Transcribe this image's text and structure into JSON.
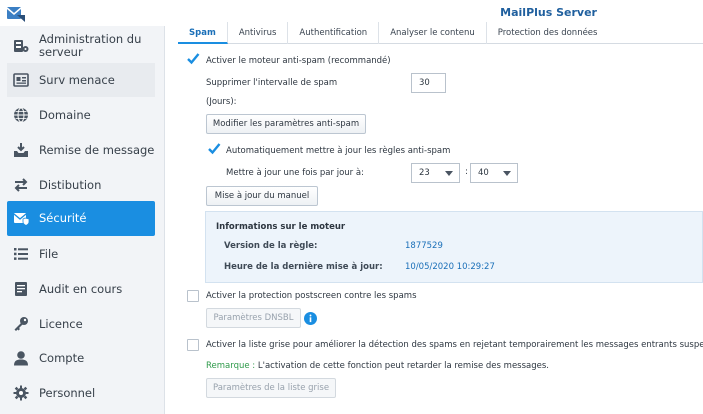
{
  "app": {
    "title": "MailPlus Server"
  },
  "sidebar": {
    "items": [
      {
        "label": "Administration du serveur",
        "icon": "server-admin-icon"
      },
      {
        "label": "Surv menace",
        "icon": "threat-monitor-icon"
      },
      {
        "label": "Domaine",
        "icon": "globe-icon"
      },
      {
        "label": "Remise de message",
        "icon": "inbox-delivery-icon"
      },
      {
        "label": "Distibution",
        "icon": "arrows-exchange-icon"
      },
      {
        "label": "Sécurité",
        "icon": "security-mail-icon"
      },
      {
        "label": "File",
        "icon": "list-icon"
      },
      {
        "label": "Audit en cours",
        "icon": "audit-doc-icon"
      },
      {
        "label": "Licence",
        "icon": "key-icon"
      },
      {
        "label": "Compte",
        "icon": "user-icon"
      },
      {
        "label": "Personnel",
        "icon": "gear-icon"
      }
    ],
    "active": "Sécurité"
  },
  "tabs": [
    {
      "label": "Spam"
    },
    {
      "label": "Antivirus"
    },
    {
      "label": "Authentification"
    },
    {
      "label": "Analyser le contenu"
    },
    {
      "label": "Protection des données"
    }
  ],
  "spam": {
    "enable_label": "Activer le moteur anti-spam (recommandé)",
    "enable_checked": true,
    "purge_label_line1": "Supprimer l'intervalle de spam",
    "purge_label_line2": "(Jours):",
    "purge_value": "30",
    "modify_button": "Modifier les paramètres anti-spam",
    "auto_update_label": "Automatiquement mettre à jour les règles anti-spam",
    "auto_update_checked": true,
    "daily_update_label": "Mettre à jour une fois par jour à:",
    "hour_value": "23",
    "time_separator": ":",
    "minute_value": "40",
    "manual_update_button": "Mise à jour du manuel",
    "engine_info": {
      "title": "Informations sur le moteur",
      "rule_version_label": "Version de la règle:",
      "rule_version_value": "1877529",
      "last_update_label": "Heure de la dernière mise à jour:",
      "last_update_value": "10/05/2020 10:29:27"
    },
    "postscreen_label": "Activer la protection postscreen contre les spams",
    "postscreen_checked": false,
    "dnsbl_button": "Paramètres DNSBL",
    "greylist_label": "Activer la liste grise pour améliorer la détection des spams en rejetant temporairement les messages entrants suspects.",
    "greylist_checked": false,
    "remark_label": "Remarque :",
    "remark_text": "L'activation de cette fonction peut retarder la remise des messages.",
    "greylist_button": "Paramètres de la liste grise"
  },
  "colors": {
    "accent": "#1a8ee1",
    "info_icon": "#1a8ee1"
  }
}
